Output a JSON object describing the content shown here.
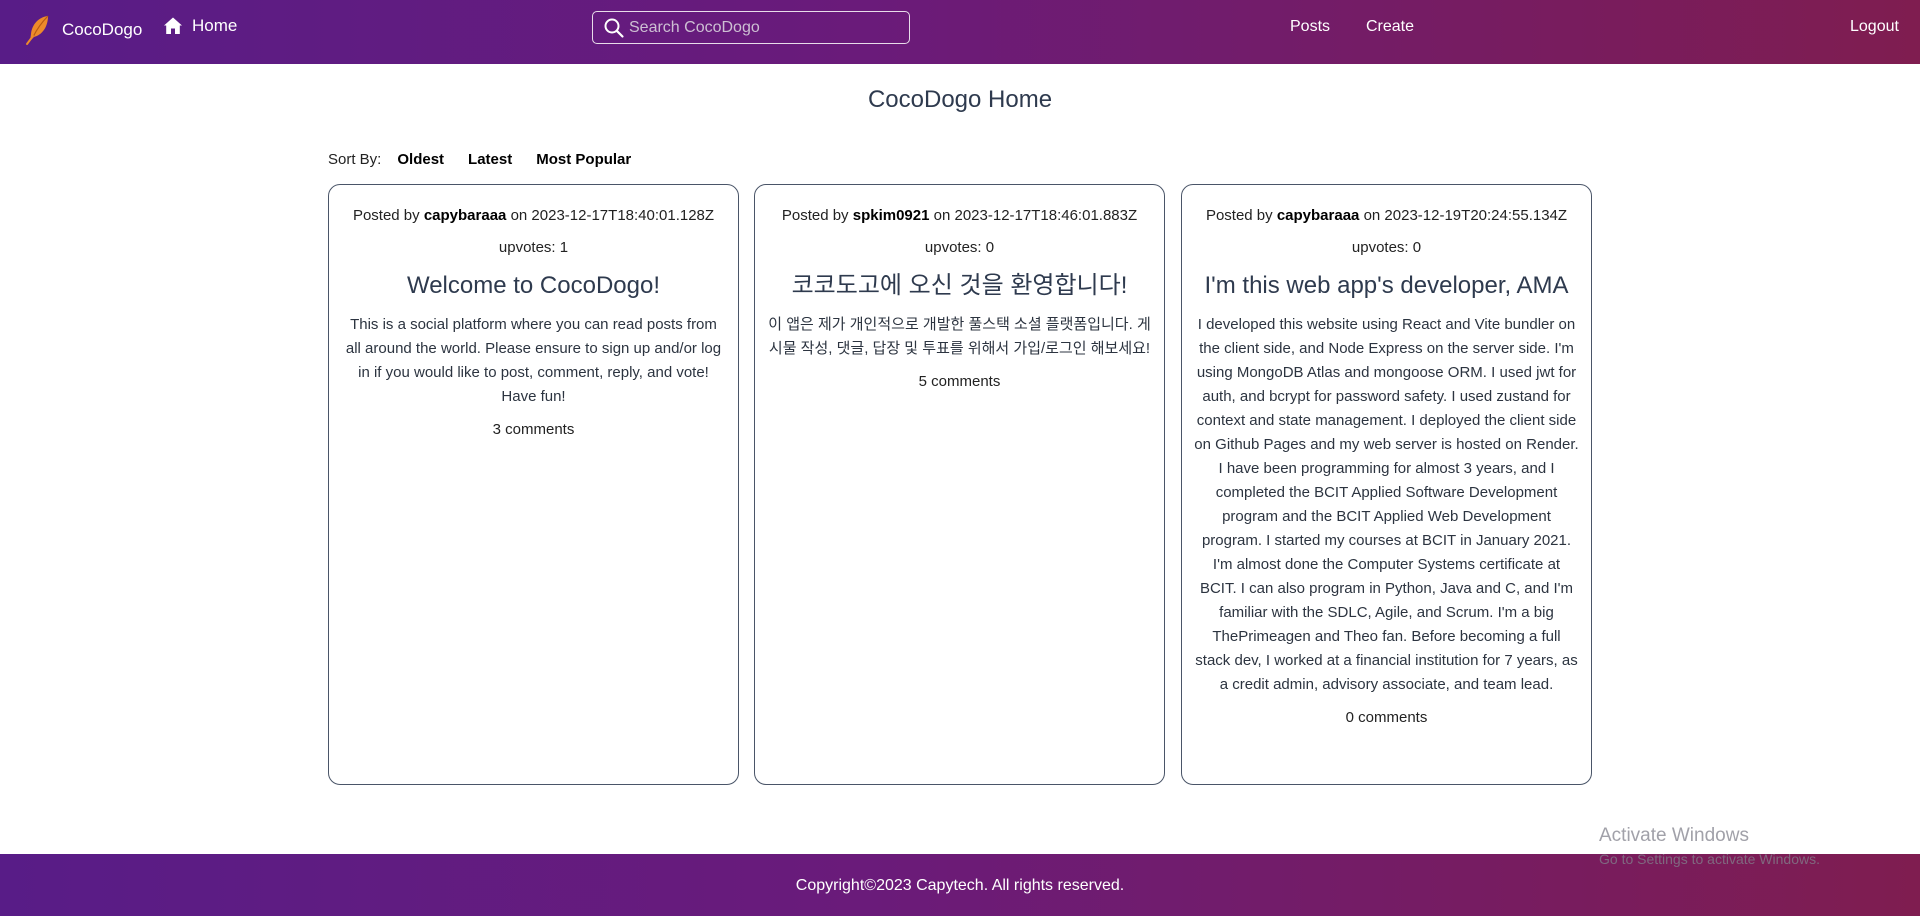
{
  "nav": {
    "brand": "CocoDogo",
    "home": "Home",
    "search_placeholder": "Search CocoDogo",
    "links": [
      "Posts",
      "Create"
    ],
    "logout": "Logout"
  },
  "page": {
    "title": "CocoDogo Home"
  },
  "sort": {
    "label": "Sort By:",
    "options": [
      "Oldest",
      "Latest",
      "Most Popular"
    ]
  },
  "posts": [
    {
      "posted_by": "Posted by",
      "author": "capybaraaa",
      "on": "on",
      "date": "2023-12-17T18:40:01.128Z",
      "upvotes": "upvotes: 1",
      "title": "Welcome to CocoDogo!",
      "body": "This is a social platform where you can read posts from all around the world. Please ensure to sign up and/or log in if you would like to post, comment, reply, and vote! Have fun!",
      "comments": "3 comments"
    },
    {
      "posted_by": "Posted by",
      "author": "spkim0921",
      "on": "on",
      "date": "2023-12-17T18:46:01.883Z",
      "upvotes": "upvotes: 0",
      "title": "코코도고에 오신 것을 환영합니다!",
      "body": "이 앱은 제가 개인적으로 개발한 풀스택 소셜 플랫폼입니다. 게시물 작성, 댓글, 답장 및 투표를 위해서 가입/로그인 해보세요!",
      "comments": "5 comments"
    },
    {
      "posted_by": "Posted by",
      "author": "capybaraaa",
      "on": "on",
      "date": "2023-12-19T20:24:55.134Z",
      "upvotes": "upvotes: 0",
      "title": "I'm this web app's developer, AMA",
      "body": "I developed this website using React and Vite bundler on the client side, and Node Express on the server side. I'm using MongoDB Atlas and mongoose ORM. I used jwt for auth, and bcrypt for password safety. I used zustand for context and state management. I deployed the client side on Github Pages and my web server is hosted on Render. I have been programming for almost 3 years, and I completed the BCIT Applied Software Development program and the BCIT Applied Web Development program. I started my courses at BCIT in January 2021. I'm almost done the Computer Systems certificate at BCIT. I can also program in Python, Java and C, and I'm familiar with the SDLC, Agile, and Scrum. I'm a big ThePrimeagen and Theo fan. Before becoming a full stack dev, I worked at a financial institution for 7 years, as a credit admin, advisory associate, and team lead.",
      "comments": "0 comments"
    }
  ],
  "footer": {
    "copyright": "Copyright©2023 Capytech. All rights reserved."
  },
  "watermark": {
    "title": "Activate Windows",
    "subtitle": "Go to Settings to activate Windows."
  },
  "colors": {
    "nav_gradient_start": "#581c87",
    "nav_gradient_end": "#7f1d50",
    "title_text": "#2e3a4e",
    "card_border": "#4a5568"
  },
  "icons": {
    "brand": "feather-logo-icon",
    "home": "home-icon",
    "search": "search-icon"
  }
}
